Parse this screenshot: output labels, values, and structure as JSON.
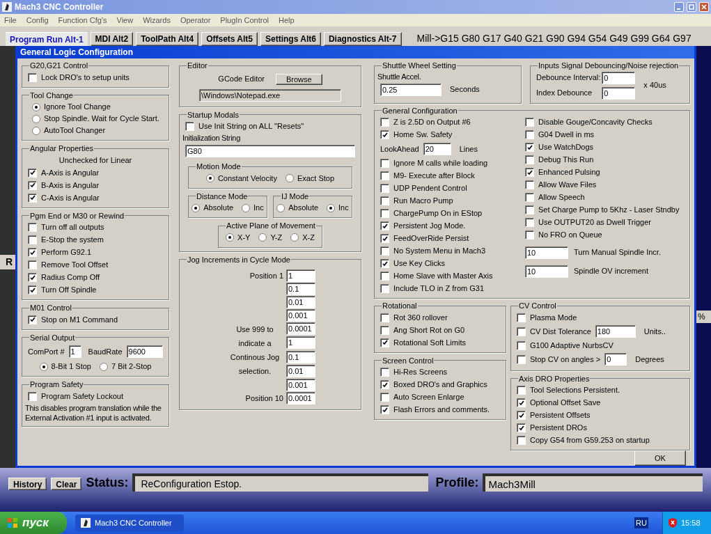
{
  "window": {
    "title": "Mach3 CNC Controller"
  },
  "menu": [
    "File",
    "Config",
    "Function Cfg's",
    "View",
    "Wizards",
    "Operator",
    "PlugIn Control",
    "Help"
  ],
  "tabs": [
    {
      "label": "Program Run Alt-1",
      "selected": true
    },
    {
      "label": "MDI Alt2",
      "selected": false
    },
    {
      "label": "ToolPath Alt4",
      "selected": false
    },
    {
      "label": "Offsets Alt5",
      "selected": false
    },
    {
      "label": "Settings Alt6",
      "selected": false
    },
    {
      "label": "Diagnostics Alt-7",
      "selected": false
    }
  ],
  "modal_line": "Mill->G15  G80 G17 G40 G21 G90 G94 G54 G49 G99 G64 G97",
  "behind": {
    "left_text": "R",
    "right_text": "%"
  },
  "dialog": {
    "title": "General Logic Configuration",
    "columns": [
      {
        "groups": [
          {
            "title": "G20,G21 Control",
            "items": [
              {
                "kind": "checkbox",
                "label": "Lock DRO's to setup units",
                "checked": false
              }
            ]
          },
          {
            "title": "Tool Change",
            "items": [
              {
                "kind": "radio_list",
                "options": [
                  {
                    "label": "Ignore Tool Change",
                    "selected": true
                  },
                  {
                    "label": "Stop Spindle. Wait for Cycle Start.",
                    "selected": false
                  },
                  {
                    "label": "AutoTool Changer",
                    "selected": false
                  }
                ]
              }
            ]
          },
          {
            "title": "Angular Properties",
            "items": [
              {
                "kind": "caption",
                "text": "Unchecked for Linear"
              },
              {
                "kind": "checkbox",
                "label": "A-Axis is Angular",
                "checked": true
              },
              {
                "kind": "checkbox",
                "label": "B-Axis is Angular",
                "checked": true
              },
              {
                "kind": "checkbox",
                "label": "C-Axis is Angular",
                "checked": true
              }
            ]
          },
          {
            "title": "Pgm End or M30 or Rewind",
            "items": [
              {
                "kind": "checkbox",
                "label": "Turn off all outputs",
                "checked": false
              },
              {
                "kind": "checkbox",
                "label": "E-Stop the system",
                "checked": false
              },
              {
                "kind": "checkbox",
                "label": "Perform G92.1",
                "checked": true
              },
              {
                "kind": "checkbox",
                "label": "Remove Tool Offset",
                "checked": false
              },
              {
                "kind": "checkbox",
                "label": "Radius Comp Off",
                "checked": true
              },
              {
                "kind": "checkbox",
                "label": "Turn Off Spindle",
                "checked": true
              }
            ]
          },
          {
            "title": "M01 Control",
            "items": [
              {
                "kind": "checkbox",
                "label": "Stop on M1 Command",
                "checked": true
              }
            ]
          },
          {
            "title": "Serial Output",
            "items": [
              {
                "kind": "field_row",
                "fields": [
                  {
                    "label": "ComPort #",
                    "value": "1"
                  },
                  {
                    "label": "BaudRate",
                    "value": "9600"
                  }
                ]
              },
              {
                "kind": "radio_row",
                "options": [
                  {
                    "label": "8-Bit 1 Stop",
                    "selected": true
                  },
                  {
                    "label": "7 Bit 2-Stop",
                    "selected": false
                  }
                ]
              }
            ]
          },
          {
            "title": "Program Safety",
            "items": [
              {
                "kind": "checkbox",
                "label": "Program Safety Lockout",
                "checked": false
              },
              {
                "kind": "text",
                "text": "This disables program translation while the External Activation #1 input is activated."
              }
            ]
          }
        ]
      },
      {
        "groups": [
          {
            "title": "Editor",
            "items": [
              {
                "kind": "button_row",
                "label": "GCode Editor",
                "button": "Browse"
              },
              {
                "kind": "wide_field",
                "value": "\\Windows\\Notepad.exe",
                "disabled": true
              }
            ]
          },
          {
            "title": "Startup Modals",
            "items": [
              {
                "kind": "checkbox",
                "label": "Use Init String on ALL  \"Resets\"",
                "checked": false
              },
              {
                "kind": "text",
                "text": "Initialization String"
              },
              {
                "kind": "wide_field",
                "value": "G80",
                "disabled": false
              },
              {
                "kind": "groups_row",
                "groups": [
                  {
                    "title": "Motion Mode",
                    "items": [
                      {
                        "kind": "radio_row",
                        "options": [
                          {
                            "label": "Constant Velocity",
                            "selected": true
                          },
                          {
                            "label": "Exact Stop",
                            "selected": false
                          }
                        ]
                      }
                    ]
                  }
                ]
              },
              {
                "kind": "groups_row",
                "groups": [
                  {
                    "title": "Distance Mode",
                    "items": [
                      {
                        "kind": "radio_row",
                        "options": [
                          {
                            "label": "Absolute",
                            "selected": true
                          },
                          {
                            "label": "Inc",
                            "selected": false
                          }
                        ]
                      }
                    ]
                  },
                  {
                    "title": "IJ Mode",
                    "items": [
                      {
                        "kind": "radio_row",
                        "options": [
                          {
                            "label": "Absolute",
                            "selected": false
                          },
                          {
                            "label": "Inc",
                            "selected": true
                          }
                        ]
                      }
                    ]
                  }
                ]
              },
              {
                "kind": "groups_row",
                "groups": [
                  {
                    "title": "Active Plane of Movement",
                    "items": [
                      {
                        "kind": "radio_row",
                        "options": [
                          {
                            "label": "X-Y",
                            "selected": true
                          },
                          {
                            "label": "Y-Z",
                            "selected": false
                          },
                          {
                            "label": "X-Z",
                            "selected": false
                          }
                        ]
                      }
                    ]
                  }
                ]
              }
            ]
          },
          {
            "title": "Jog Increments in Cycle Mode",
            "items": [
              {
                "kind": "jog_list",
                "first_label": "Position 1",
                "middle_text": "Use 999 to indicate a Continous Jog selection.",
                "last_label": "Position 10",
                "values": [
                  "1",
                  "0.1",
                  "0.01",
                  "0.001",
                  "0.0001",
                  "1",
                  "0.1",
                  "0.01",
                  "0.001",
                  "0.0001"
                ]
              }
            ]
          }
        ]
      }
    ],
    "top_groups": [
      {
        "title": "Shuttle Wheel Setting",
        "items": [
          {
            "kind": "text",
            "text": "Shuttle Accel."
          },
          {
            "kind": "field",
            "value": "0.25",
            "suffix": "Seconds"
          }
        ]
      },
      {
        "title": "Inputs Signal Debouncing/Noise rejection",
        "items": [
          {
            "kind": "debounce",
            "fields": [
              {
                "label": "Debounce Interval:",
                "value": "0"
              },
              {
                "label": "Index Debounce",
                "value": "0"
              }
            ],
            "note": "x 40us"
          }
        ]
      }
    ],
    "general": {
      "title": "General Configuration",
      "left_items": [
        {
          "kind": "checkbox",
          "label": "Z is 2.5D on Output #6",
          "checked": false
        },
        {
          "kind": "checkbox",
          "label": "Home Sw. Safety",
          "checked": true
        },
        {
          "kind": "field",
          "label": "LookAhead",
          "value": "20",
          "suffix": "Lines"
        },
        {
          "kind": "checkbox",
          "label": "Ignore M calls while loading",
          "checked": false
        },
        {
          "kind": "checkbox",
          "label": "M9- Execute after Block",
          "checked": false
        },
        {
          "kind": "checkbox",
          "label": "UDP Pendent Control",
          "checked": false
        },
        {
          "kind": "checkbox",
          "label": "Run Macro Pump",
          "checked": false
        },
        {
          "kind": "checkbox",
          "label": "ChargePump On in EStop",
          "checked": false
        },
        {
          "kind": "checkbox",
          "label": "Persistent Jog Mode.",
          "checked": true
        },
        {
          "kind": "checkbox",
          "label": "FeedOverRide Persist",
          "checked": true
        },
        {
          "kind": "checkbox",
          "label": "No System Menu in Mach3",
          "checked": false
        },
        {
          "kind": "checkbox",
          "label": "Use Key Clicks",
          "checked": true
        },
        {
          "kind": "checkbox",
          "label": "Home Slave with Master Axis",
          "checked": false
        },
        {
          "kind": "checkbox",
          "label": "Include TLO in Z from G31",
          "checked": false
        }
      ],
      "right_items": [
        {
          "kind": "checkbox",
          "label": "Disable Gouge/Concavity Checks",
          "checked": false
        },
        {
          "kind": "checkbox",
          "label": "G04 Dwell in ms",
          "checked": false
        },
        {
          "kind": "checkbox",
          "label": "Use WatchDogs",
          "checked": true
        },
        {
          "kind": "checkbox",
          "label": "Debug This Run",
          "checked": false
        },
        {
          "kind": "checkbox",
          "label": "Enhanced Pulsing",
          "checked": true
        },
        {
          "kind": "checkbox",
          "label": "Allow Wave Files",
          "checked": false
        },
        {
          "kind": "checkbox",
          "label": "Allow Speech",
          "checked": false
        },
        {
          "kind": "checkbox",
          "label": "Set Charge Pump to 5Khz  - Laser Stndby",
          "checked": false
        },
        {
          "kind": "checkbox",
          "label": "Use OUTPUT20 as Dwell Trigger",
          "checked": false
        },
        {
          "kind": "checkbox",
          "label": "No FRO on Queue",
          "checked": false
        },
        {
          "kind": "value_field",
          "value": "10",
          "suffix": "Turn Manual Spindle Incr."
        },
        {
          "kind": "value_field",
          "value": "10",
          "suffix": "Spindle OV increment"
        }
      ]
    },
    "bottom_left": [
      {
        "title": "Rotational",
        "items": [
          {
            "kind": "checkbox",
            "label": "Rot 360 rollover",
            "checked": false
          },
          {
            "kind": "checkbox",
            "label": "Ang Short Rot on G0",
            "checked": false
          },
          {
            "kind": "checkbox",
            "label": "Rotational Soft Limits",
            "checked": true
          }
        ]
      },
      {
        "title": "Screen Control",
        "items": [
          {
            "kind": "checkbox",
            "label": "Hi-Res Screens",
            "checked": false
          },
          {
            "kind": "checkbox",
            "label": "Boxed DRO's and Graphics",
            "checked": true
          },
          {
            "kind": "checkbox",
            "label": "Auto Screen Enlarge",
            "checked": false
          },
          {
            "kind": "checkbox",
            "label": "Flash Errors and comments.",
            "checked": true
          }
        ]
      }
    ],
    "bottom_right": [
      {
        "title": "CV Control",
        "items": [
          {
            "kind": "checkbox",
            "label": "Plasma Mode",
            "checked": false
          },
          {
            "kind": "checkbox_field",
            "label": "CV Dist Tolerance",
            "checked": false,
            "value": "180",
            "suffix": "Units.."
          },
          {
            "kind": "checkbox",
            "label": "G100 Adaptive NurbsCV",
            "checked": false
          },
          {
            "kind": "checkbox_field",
            "label": "Stop CV on angles >",
            "checked": false,
            "value": "0",
            "suffix": "Degrees"
          }
        ]
      },
      {
        "title": "Axis DRO Properties",
        "items": [
          {
            "kind": "checkbox",
            "label": "Tool Selections Persistent.",
            "checked": false
          },
          {
            "kind": "checkbox",
            "label": "Optional Offset Save",
            "checked": true
          },
          {
            "kind": "checkbox",
            "label": "Persistent Offsets",
            "checked": true
          },
          {
            "kind": "checkbox",
            "label": "Persistent DROs",
            "checked": true
          },
          {
            "kind": "checkbox",
            "label": "Copy G54 from G59.253 on startup",
            "checked": false
          }
        ]
      }
    ],
    "ok_button": "OK"
  },
  "status_bar": {
    "buttons": [
      "History",
      "Clear"
    ],
    "status_label": "Status:",
    "status_value": "ReConfiguration Estop.",
    "profile_label": "Profile:",
    "profile_value": "Mach3Mill"
  },
  "taskbar": {
    "start": "пуск",
    "task": "Mach3 CNC Controller",
    "language": "RU",
    "clock": "15:58"
  }
}
